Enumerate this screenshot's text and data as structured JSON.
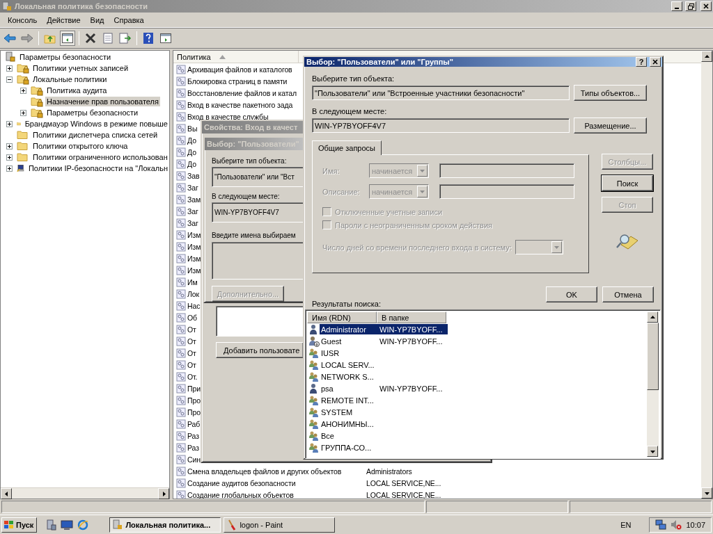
{
  "window": {
    "title": "Локальная политика безопасности",
    "active": false
  },
  "menu": [
    "Консоль",
    "Действие",
    "Вид",
    "Справка"
  ],
  "tree": [
    {
      "label": "Параметры безопасности",
      "kind": "root",
      "selected": false,
      "children": [
        {
          "label": "Политики учетных записей",
          "kind": "secure-folder",
          "expanded": false,
          "selected": false
        },
        {
          "label": "Локальные политики",
          "kind": "secure-folder",
          "expanded": true,
          "selected": false,
          "children": [
            {
              "label": "Политика аудита",
              "kind": "secure-folder",
              "expanded": false,
              "selected": false
            },
            {
              "label": "Назначение прав пользователя",
              "kind": "secure-folder",
              "selected": true
            },
            {
              "label": "Параметры безопасности",
              "kind": "secure-folder",
              "expanded": false,
              "selected": false
            }
          ]
        },
        {
          "label": "Брандмауэр Windows в режиме повыше",
          "kind": "folder",
          "expanded": false,
          "selected": false
        },
        {
          "label": "Политики диспетчера списка сетей",
          "kind": "folder",
          "selected": false
        },
        {
          "label": "Политики открытого ключа",
          "kind": "folder",
          "expanded": false,
          "selected": false
        },
        {
          "label": "Политики ограниченного использован",
          "kind": "folder",
          "expanded": false,
          "selected": false
        },
        {
          "label": "Политики IP-безопасности на \"Локальн",
          "kind": "network-policy",
          "expanded": false,
          "selected": false
        }
      ]
    }
  ],
  "policy_header": "Политика",
  "policies": [
    {
      "name": "Архивация файлов и каталогов"
    },
    {
      "name": "Блокировка страниц в памяти"
    },
    {
      "name": "Восстановление файлов и катал"
    },
    {
      "name": "Вход в качестве пакетного зада"
    },
    {
      "name": "Вход в качестве службы"
    },
    {
      "name": "Вы"
    },
    {
      "name": "До"
    },
    {
      "name": "До"
    },
    {
      "name": "До"
    },
    {
      "name": "Зав"
    },
    {
      "name": "Заг"
    },
    {
      "name": "Зам"
    },
    {
      "name": "Заг"
    },
    {
      "name": "Заг"
    },
    {
      "name": "Изм"
    },
    {
      "name": "Изм"
    },
    {
      "name": "Изм"
    },
    {
      "name": "Изм"
    },
    {
      "name": "Им"
    },
    {
      "name": "Лок"
    },
    {
      "name": "Нас"
    },
    {
      "name": "Об"
    },
    {
      "name": "От"
    },
    {
      "name": "От"
    },
    {
      "name": "От"
    },
    {
      "name": "От"
    },
    {
      "name": "От."
    },
    {
      "name": "При"
    },
    {
      "name": "Про"
    },
    {
      "name": "Про"
    },
    {
      "name": "Раб"
    },
    {
      "name": "Раз"
    },
    {
      "name": "Раз"
    },
    {
      "name": "Син"
    },
    {
      "name": "Смена владельцев файлов и других объектов",
      "value": "Administrators"
    },
    {
      "name": "Создание аудитов безопасности",
      "value": "LOCAL SERVICE,NE..."
    },
    {
      "name": "Создание глобальных объектов",
      "value": "LOCAL SERVICE,NE..."
    }
  ],
  "properties_dialog": {
    "title": "Свойства: Вход в качест",
    "active": false,
    "add_button": "Добавить пользовате"
  },
  "back_select_dialog": {
    "title": "Выбор: \"Пользователи\"",
    "active": false,
    "object_type_label": "Выберите тип объекта:",
    "object_type": "\"Пользователи\" или \"Вст",
    "location_label": "В следующем месте:",
    "location": "WIN-YP7BYOFF4V7",
    "names_label": "Введите имена выбираем",
    "advanced_button": {
      "label": "Дополнительно...",
      "disabled": true
    }
  },
  "select_dialog": {
    "title": "Выбор: \"Пользователи\" или \"Группы\"",
    "active": true,
    "help": "?",
    "object_type_label": "Выберите тип объекта:",
    "object_type": "\"Пользователи\" или \"Встроенные участники безопасности\"",
    "object_types_button": "Типы объектов...",
    "location_label": "В следующем месте:",
    "location": "WIN-YP7BYOFF4V7",
    "location_button": "Размещение...",
    "tabs": [
      {
        "label": "Общие запросы",
        "selected": true
      }
    ],
    "query_fields": [
      {
        "label": "Имя:",
        "mode": "начинается",
        "disabled": true
      },
      {
        "label": "Описание:",
        "mode": "начинается",
        "disabled": true
      }
    ],
    "checkboxes": [
      {
        "label": "Отключенные учетные записи",
        "checked": false,
        "disabled": true
      },
      {
        "label": "Пароли с неограниченным сроком действия",
        "checked": false,
        "disabled": true
      }
    ],
    "days_label": "Число дней со времени последнего входа в систему:",
    "side_buttons": [
      {
        "label": "Столбцы...",
        "disabled": true,
        "default": false
      },
      {
        "label": "Поиск",
        "disabled": false,
        "default": true
      },
      {
        "label": "Стоп",
        "disabled": true,
        "default": false
      }
    ],
    "ok": "OK",
    "cancel": "Отмена",
    "results_label": "Результаты поиска:",
    "results_columns": [
      "Имя (RDN)",
      "В папке"
    ],
    "results": [
      {
        "name": "Administrator",
        "folder": "WIN-YP7BYOFF...",
        "kind": "user",
        "selected": true
      },
      {
        "name": "Guest",
        "folder": "WIN-YP7BYOFF...",
        "kind": "guest",
        "selected": false
      },
      {
        "name": "IUSR",
        "kind": "group",
        "selected": false
      },
      {
        "name": "LOCAL SERV...",
        "kind": "group",
        "selected": false
      },
      {
        "name": "NETWORK S...",
        "kind": "group",
        "selected": false
      },
      {
        "name": "psa",
        "folder": "WIN-YP7BYOFF...",
        "kind": "user",
        "selected": false
      },
      {
        "name": "REMOTE INT...",
        "kind": "group",
        "selected": false
      },
      {
        "name": "SYSTEM",
        "kind": "group",
        "selected": false
      },
      {
        "name": "АНОНИМНЫ...",
        "kind": "group",
        "selected": false
      },
      {
        "name": "Все",
        "kind": "group",
        "selected": false
      },
      {
        "name": "ГРУППА-СО...",
        "kind": "group",
        "selected": false
      }
    ]
  },
  "taskbar": {
    "start": "Пуск",
    "tasks": [
      {
        "label": "Локальная политика...",
        "selected": true,
        "kind": "policy"
      },
      {
        "label": "logon - Paint",
        "selected": false,
        "kind": "paint"
      }
    ],
    "language": "EN",
    "clock": "10:07"
  }
}
